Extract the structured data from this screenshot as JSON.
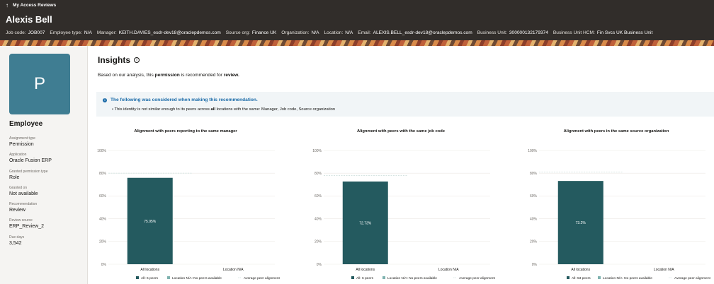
{
  "header": {
    "back_label": "My Access Reviews",
    "name": "Alexis Bell",
    "meta": [
      {
        "k": "Job code:",
        "v": "JOB007"
      },
      {
        "k": "Employee type:",
        "v": "N/A"
      },
      {
        "k": "Manager:",
        "v": "KEITH.DAVIES_esdr-dev18@oraclepdemos.com"
      },
      {
        "k": "Source org:",
        "v": "Finance UK"
      },
      {
        "k": "Organization:",
        "v": "N/A"
      },
      {
        "k": "Location:",
        "v": "N/A"
      },
      {
        "k": "Email:",
        "v": "ALEXIS.BELL_esdr-dev18@oraclepdemos.com"
      },
      {
        "k": "Business Unit:",
        "v": "300000132179374"
      },
      {
        "k": "Business Unit HCM:",
        "v": "Fin Svcs UK Business Unit"
      }
    ]
  },
  "sidebar": {
    "avatar_letter": "P",
    "title": "Employee",
    "attributes": [
      {
        "k": "Assignment type",
        "v": "Permission"
      },
      {
        "k": "Application",
        "v": "Oracle Fusion ERP"
      },
      {
        "k": "Granted permission type",
        "v": "Role"
      },
      {
        "k": "Granted on",
        "v": "Not available"
      },
      {
        "k": "Recommendation",
        "v": "Review"
      },
      {
        "k": "Review source",
        "v": "ERP_Review_2"
      },
      {
        "k": "Due days",
        "v": "3,542"
      }
    ]
  },
  "main": {
    "title": "Insights",
    "summary_pre": "Based on our analysis, this ",
    "summary_bold1": "permission",
    "summary_mid": " is recommended for ",
    "summary_bold2": "review.",
    "notice": {
      "title": "The following was considered when making this recommendation.",
      "body_pre": "• This identity is not similar enough to its peers across ",
      "body_bold": "all",
      "body_post": " locations with the same: Manager, Job code, Source organization"
    }
  },
  "colors": {
    "bar": "#245a5f",
    "legend_secondary": "#7fb3b0",
    "header_bg": "#312d2a",
    "accent": "#1b6ba8"
  },
  "chart_data": [
    {
      "type": "bar",
      "title": "Alignment with peers reporting to the same manager",
      "categories": [
        "All locations",
        "Location N/A"
      ],
      "values": [
        75.95,
        null
      ],
      "value_labels": [
        "75.95%",
        ""
      ],
      "average_line": 80,
      "yticks": [
        "0%",
        "20%",
        "40%",
        "60%",
        "80%",
        "100%"
      ],
      "ylim": [
        0,
        100
      ],
      "legend": [
        "All: 6 peers",
        "Location N/A: No peers available",
        "Average peer alignment"
      ]
    },
    {
      "type": "bar",
      "title": "Alignment with peers with the same job code",
      "categories": [
        "All locations",
        "Location N/A"
      ],
      "values": [
        72.73,
        null
      ],
      "value_labels": [
        "72.73%",
        ""
      ],
      "average_line": 78,
      "yticks": [
        "0%",
        "20%",
        "40%",
        "60%",
        "80%",
        "100%"
      ],
      "ylim": [
        0,
        100
      ],
      "legend": [
        "All: 6 peers",
        "Location N/A: No peers available",
        "Average peer alignment"
      ]
    },
    {
      "type": "bar",
      "title": "Alignment with peers in the same source organization",
      "categories": [
        "All locations",
        "Location N/A"
      ],
      "values": [
        73.2,
        null
      ],
      "value_labels": [
        "73.2%",
        ""
      ],
      "average_line": 81,
      "yticks": [
        "0%",
        "20%",
        "40%",
        "60%",
        "80%",
        "100%"
      ],
      "ylim": [
        0,
        100
      ],
      "legend": [
        "All: 53 peers",
        "Location N/A: No peers available",
        "Average peer alignment"
      ]
    }
  ]
}
